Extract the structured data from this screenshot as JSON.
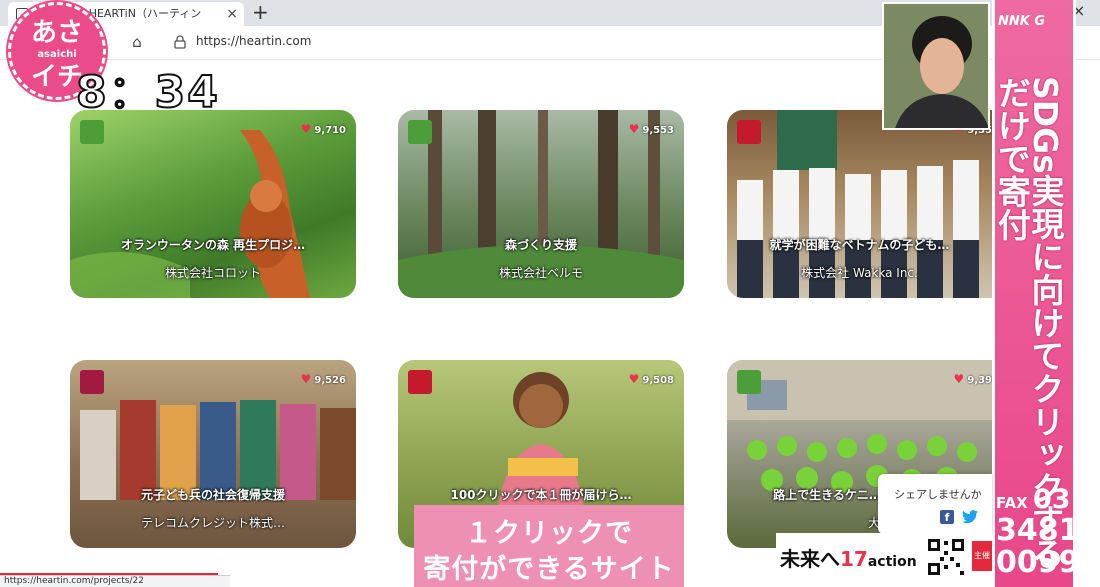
{
  "browser": {
    "tab_title": "ック募金 | HEARTiN（ハーティン",
    "tab_close": "×",
    "new_tab": "+",
    "window_close": "×",
    "url": "https://heartin.com",
    "status_url": "https://heartin.com/projects/22"
  },
  "overlay": {
    "clock": "8：34",
    "logo_text": "あさイチ",
    "logo_sub": "asaichi",
    "caption": [
      "１クリックで",
      "寄付ができるサイト"
    ],
    "network_logo": "NNK G",
    "side_vertical_text": "SDGs実現に向けてクリックするだけで寄付",
    "fax_label": "FAX",
    "fax_numbers": [
      "03",
      "3481",
      "0099"
    ],
    "mirai_text_a": "未来へ",
    "mirai_text_b": "17",
    "mirai_text_c": "action",
    "red_tag_text": "主催"
  },
  "share": {
    "label": "シェアしませんか",
    "facebook": "f",
    "twitter": "🐦"
  },
  "colors": {
    "brand_pink": "#e8478a",
    "heart_red": "#e8334a",
    "sdg_green": "#4c9f38",
    "sdg_red": "#c5192d",
    "sdg_orange": "#e5243b"
  },
  "cards": [
    {
      "title": "オランウータンの森 再生プロジ…",
      "org": "株式会社コロット",
      "likes": "9,710",
      "badge": "sdg-15-life-on-land-icon"
    },
    {
      "title": "森づくり支援",
      "org": "株式会社ベルモ",
      "likes": "9,553",
      "badge": "sdg-15-life-on-land-icon"
    },
    {
      "title": "就学が困難なベトナムの子ども…",
      "org": "株式会社 Wakka Inc.",
      "likes": "9,55",
      "badge": "sdg-4-quality-education-icon"
    },
    {
      "title": "元子ども兵の社会復帰支援",
      "org": "テレコムクレジット株式…",
      "likes": "9,526",
      "badge": "sdg-8-decent-work-icon"
    },
    {
      "title": "100クリックで本１冊が届けら…",
      "org": "",
      "likes": "9,508",
      "badge": "sdg-4-quality-education-icon"
    },
    {
      "title": "路上で生きるケニ…",
      "org": "大…",
      "likes": "9,39",
      "badge": "sdg-3-good-health-icon"
    }
  ]
}
